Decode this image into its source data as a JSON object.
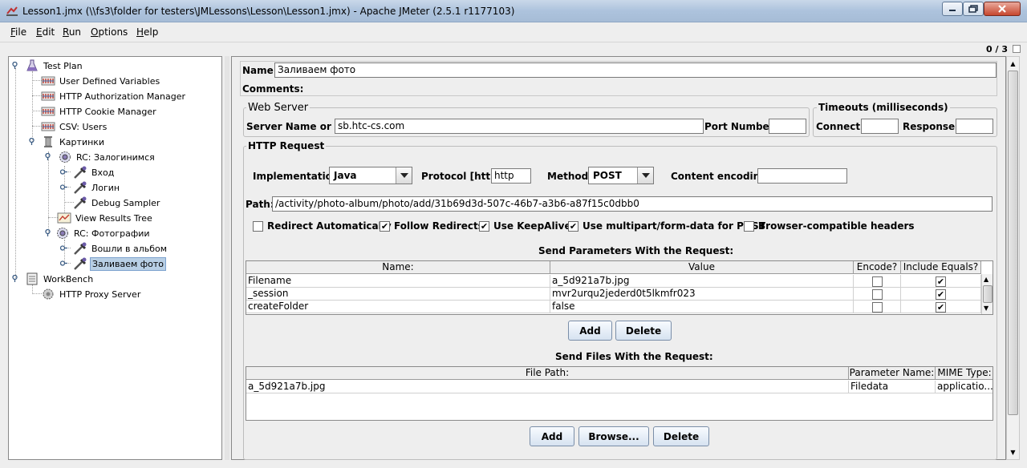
{
  "window": {
    "title": "Lesson1.jmx (\\\\fs3\\folder for testers\\JMLessons\\Lesson\\Lesson1.jmx) - Apache JMeter (2.5.1 r1177103)"
  },
  "menu": [
    {
      "first": "F",
      "rest": "ile"
    },
    {
      "first": "E",
      "rest": "dit"
    },
    {
      "first": "R",
      "rest": "un"
    },
    {
      "first": "O",
      "rest": "ptions"
    },
    {
      "first": "H",
      "rest": "elp"
    }
  ],
  "status": {
    "counter": "0 / 3"
  },
  "tree": {
    "test_plan": "Test Plan",
    "user_defined_variables": "User Defined Variables",
    "http_auth_manager": "HTTP Authorization Manager",
    "http_cookie_manager": "HTTP Cookie Manager",
    "csv_users": "CSV: Users",
    "thread_group": "Картинки",
    "rc_login": "RC: Залогинимся",
    "entry": "Вход",
    "login": "Логин",
    "debug_sampler": "Debug Sampler",
    "view_results_tree": "View Results Tree",
    "rc_photos": "RC: Фотографии",
    "album": "Вошли в альбом",
    "upload_photo": "Заливаем фото",
    "workbench": "WorkBench",
    "http_proxy_server": "HTTP Proxy Server"
  },
  "form": {
    "name_label": "Name:",
    "name_value": "Заливаем фото",
    "comments_label": "Comments:",
    "web_server": {
      "title": "Web Server",
      "server_label": "Server Name or IP:",
      "server_value": "sb.htc-cs.com",
      "port_label": "Port Number:",
      "port_value": ""
    },
    "timeouts": {
      "title": "Timeouts (milliseconds)",
      "connect_label": "Connect:",
      "connect_value": "",
      "response_label": "Response:",
      "response_value": ""
    },
    "http_request": {
      "title": "HTTP Request",
      "implementation_label": "Implementation:",
      "implementation_value": "Java",
      "protocol_label": "Protocol [http]:",
      "protocol_value": "http",
      "method_label": "Method:",
      "method_value": "POST",
      "encoding_label": "Content encoding:",
      "encoding_value": "",
      "path_label": "Path:",
      "path_value": "/activity/photo-album/photo/add/31b69d3d-507c-46b7-a3b6-a87f15c0dbb0",
      "options": [
        {
          "label": "Redirect Automatically",
          "checked": false
        },
        {
          "label": "Follow Redirects",
          "checked": true
        },
        {
          "label": "Use KeepAlive",
          "checked": true
        },
        {
          "label": "Use multipart/form-data for POST",
          "checked": true
        },
        {
          "label": "Browser-compatible headers",
          "checked": false
        }
      ]
    }
  },
  "params": {
    "title": "Send Parameters With the Request:",
    "columns": [
      "Name:",
      "Value",
      "Encode?",
      "Include Equals?"
    ],
    "rows": [
      {
        "name": "Filename",
        "value": "a_5d921a7b.jpg",
        "encode": false,
        "include_equals": true
      },
      {
        "name": "_session",
        "value": "mvr2urqu2jederd0t5lkmfr023",
        "encode": false,
        "include_equals": true
      },
      {
        "name": "createFolder",
        "value": "false",
        "encode": false,
        "include_equals": true
      }
    ],
    "add_label": "Add",
    "delete_label": "Delete"
  },
  "files": {
    "title": "Send Files With the Request:",
    "columns": [
      "File Path:",
      "Parameter Name:",
      "MIME Type:"
    ],
    "rows": [
      {
        "path": "a_5d921a7b.jpg",
        "param": "Filedata",
        "mime": "applicatio..."
      }
    ],
    "add_label": "Add",
    "browse_label": "Browse...",
    "delete_label": "Delete"
  },
  "icons": {
    "check": "✔",
    "arrow_up": "▲",
    "arrow_down": "▼"
  },
  "colors": {
    "selection": "#b8cfe5",
    "titlebar": "#adc3dd"
  }
}
